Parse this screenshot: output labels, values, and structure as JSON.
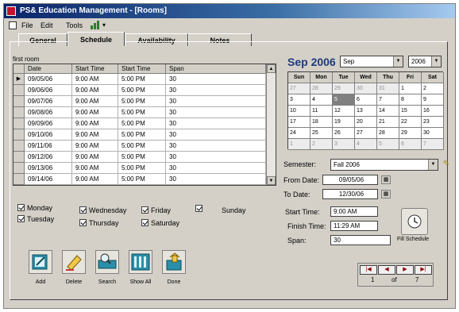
{
  "window": {
    "title": "PS& Education Management - [Rooms]"
  },
  "menu": [
    "File",
    "Edit",
    "Tools"
  ],
  "tabs": [
    "General",
    "Schedule",
    "Availability",
    "Notes"
  ],
  "grid": {
    "caption": "first room",
    "columns": [
      "Date",
      "Start Time",
      "Start Time",
      "Span"
    ],
    "rows": [
      [
        "09/05/06",
        "9:00 AM",
        "5:00 PM",
        "30"
      ],
      [
        "09/06/06",
        "9:00 AM",
        "5:00 PM",
        "30"
      ],
      [
        "09/07/06",
        "9:00 AM",
        "5:00 PM",
        "30"
      ],
      [
        "09/08/06",
        "9:00 AM",
        "5:00 PM",
        "30"
      ],
      [
        "09/09/06",
        "9:00 AM",
        "5:00 PM",
        "30"
      ],
      [
        "09/10/06",
        "9:00 AM",
        "5:00 PM",
        "30"
      ],
      [
        "09/11/06",
        "9:00 AM",
        "5:00 PM",
        "30"
      ],
      [
        "09/12/06",
        "9:00 AM",
        "5:00 PM",
        "30"
      ],
      [
        "09/13/06",
        "9:00 AM",
        "5:00 PM",
        "30"
      ],
      [
        "09/14/06",
        "9:00 AM",
        "5:00 PM",
        "30"
      ]
    ]
  },
  "days": {
    "monday": "Monday",
    "tuesday": "Tuesday",
    "wednesday": "Wednesday",
    "thursday": "Thursday",
    "friday": "Friday",
    "saturday": "Saturday",
    "sunday": "Sunday"
  },
  "toolbar": {
    "add": "Add",
    "delete": "Delete",
    "search": "Search",
    "show_all": "Show All",
    "done": "Done"
  },
  "calendar": {
    "title": "Sep 2006",
    "month_select": "Sep",
    "year_select": "2006",
    "weekdays": [
      "Sun",
      "Mon",
      "Tue",
      "Wed",
      "Thu",
      "Fri",
      "Sat"
    ],
    "weeks": [
      [
        "27",
        "28",
        "29",
        "30",
        "31",
        "1",
        "2"
      ],
      [
        "3",
        "4",
        "5",
        "6",
        "7",
        "8",
        "9"
      ],
      [
        "10",
        "11",
        "12",
        "13",
        "14",
        "15",
        "16"
      ],
      [
        "17",
        "18",
        "19",
        "20",
        "21",
        "22",
        "23"
      ],
      [
        "24",
        "25",
        "26",
        "27",
        "28",
        "29",
        "30"
      ],
      [
        "1",
        "2",
        "3",
        "4",
        "5",
        "6",
        "7"
      ]
    ],
    "selected_day": "5"
  },
  "form": {
    "semester_label": "Semester:",
    "semester": "Fall 2006",
    "from_label": "From Date:",
    "from": "09/05/06",
    "to_label": "To Date:",
    "to": "12/30/06",
    "start_label": "Start Time:",
    "start": "9:00 AM",
    "finish_label": "Finish Time:",
    "finish": "11:29 AM",
    "span_label": "Span:",
    "span": "30"
  },
  "fill_schedule_label": "Fill Schedule",
  "record_nav": {
    "current": "1",
    "of_label": "of",
    "total": "7"
  }
}
